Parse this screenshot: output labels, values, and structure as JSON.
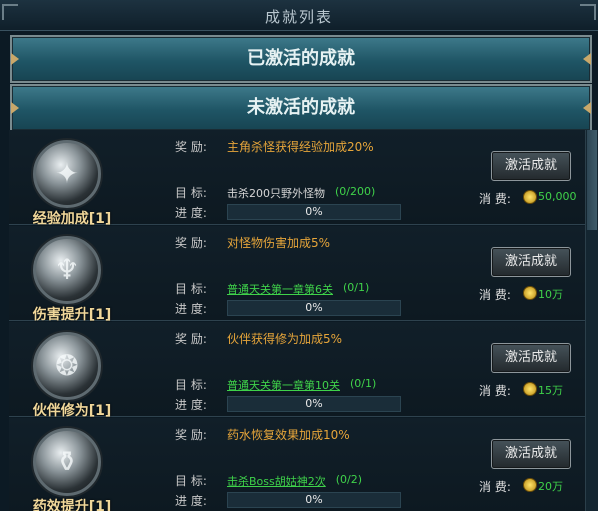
{
  "window": {
    "title": "成就列表"
  },
  "sections": {
    "activated": "已激活的成就",
    "inactive": "未激活的成就"
  },
  "labels": {
    "reward": "奖   励:",
    "target": "目   标:",
    "progress": "进   度:",
    "cost": "消   费:"
  },
  "achievements": [
    {
      "name": "经验加成[1]",
      "icon": "sparkle-emblem-icon",
      "reward": "主角杀怪获得经验加成20%",
      "target": "击杀200只野外怪物",
      "target_link": false,
      "count": "(0/200)",
      "progress": "0%",
      "button": "激活成就",
      "cost": "50,000"
    },
    {
      "name": "伤害提升[1]",
      "icon": "trident-emblem-icon",
      "reward": "对怪物伤害加成5%",
      "target": "普通天关第一章第6关",
      "target_link": true,
      "count": "(0/1)",
      "progress": "0%",
      "button": "激活成就",
      "cost": "10万"
    },
    {
      "name": "伙伴修为[1]",
      "icon": "flame-emblem-icon",
      "reward": "伙伴获得修为加成5%",
      "target": "普通天关第一章第10关",
      "target_link": true,
      "count": "(0/1)",
      "progress": "0%",
      "button": "激活成就",
      "cost": "15万"
    },
    {
      "name": "药效提升[1]",
      "icon": "chest-emblem-icon",
      "reward": "药水恢复效果加成10%",
      "target": "击杀Boss胡姑神2次",
      "target_link": true,
      "count": "(0/2)",
      "progress": "0%",
      "button": "激活成就",
      "cost": "20万"
    }
  ],
  "colors": {
    "accent_green": "#3fd24a",
    "reward_orange": "#e6a53a",
    "name_gold": "#f0d79a",
    "section_teal": "#1f5565"
  }
}
